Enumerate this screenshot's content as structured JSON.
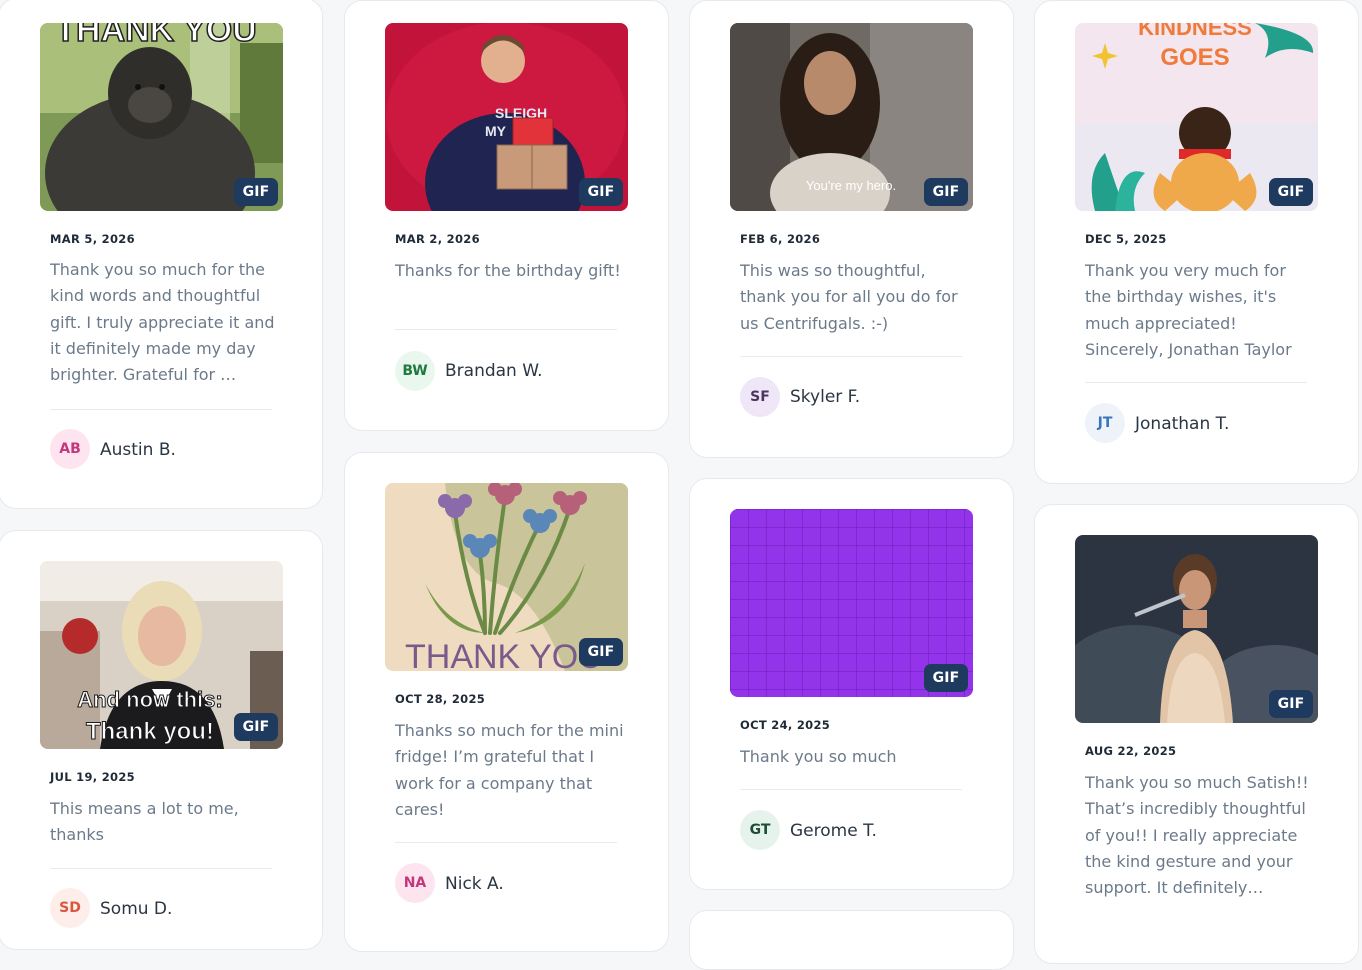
{
  "badge_label": "GIF",
  "cards": [
    {
      "date": "MAR 5, 2026",
      "message": "Thank you so much for the kind words and thoughtful gift. I truly appreciate it and it definitely made my day brighter. Grateful for …",
      "initials": "AB",
      "author": "Austin B.",
      "gif_caption": "THANK YOU",
      "avatar_bg": "#fde4ef",
      "avatar_fg": "#c2377d"
    },
    {
      "date": "MAR 2, 2026",
      "message": "Thanks for the birthday gift!",
      "initials": "BW",
      "author": "Brandan W.",
      "avatar_bg": "#eaf7ee",
      "avatar_fg": "#1f7a3d"
    },
    {
      "date": "FEB 6, 2026",
      "message": "This was so thoughtful, thank you for all you do for us Centrifugals. :-)",
      "initials": "SF",
      "author": "Skyler F.",
      "gif_caption": "You're my hero.",
      "avatar_bg": "#efe6f7",
      "avatar_fg": "#4a3561"
    },
    {
      "date": "DEC 5, 2025",
      "message": "Thank you very much for the birthday wishes, it's much appreciated! Sincerely, Jonathan Taylor",
      "initials": "JT",
      "author": "Jonathan T.",
      "gif_caption_line1": "KINDNESS",
      "gif_caption_line2": "GOES",
      "avatar_bg": "#eef3fa",
      "avatar_fg": "#3b74b8"
    },
    {
      "date": "JUL 19, 2025",
      "message": "This means a lot to me, thanks",
      "initials": "SD",
      "author": "Somu D.",
      "gif_caption_line1": "And now this:",
      "gif_caption_line2": "Thank you!",
      "avatar_bg": "#fdeeea",
      "avatar_fg": "#d9573f"
    },
    {
      "date": "OCT 28, 2025",
      "message": "Thanks so much for the mini fridge! I’m grateful that I work for a company that cares!",
      "initials": "NA",
      "author": "Nick A.",
      "gif_caption": "THANK YOU",
      "avatar_bg": "#fde4ef",
      "avatar_fg": "#c2377d"
    },
    {
      "date": "OCT 24, 2025",
      "message": "Thank you so much",
      "initials": "GT",
      "author": "Gerome T.",
      "avatar_bg": "#e6f3ec",
      "avatar_fg": "#1d4d36"
    },
    {
      "date": "AUG 22, 2025",
      "message": "Thank you so much Satish!! That’s incredibly thoughtful of you!! I really appreciate the kind gesture and your support. It definitely…"
    }
  ]
}
